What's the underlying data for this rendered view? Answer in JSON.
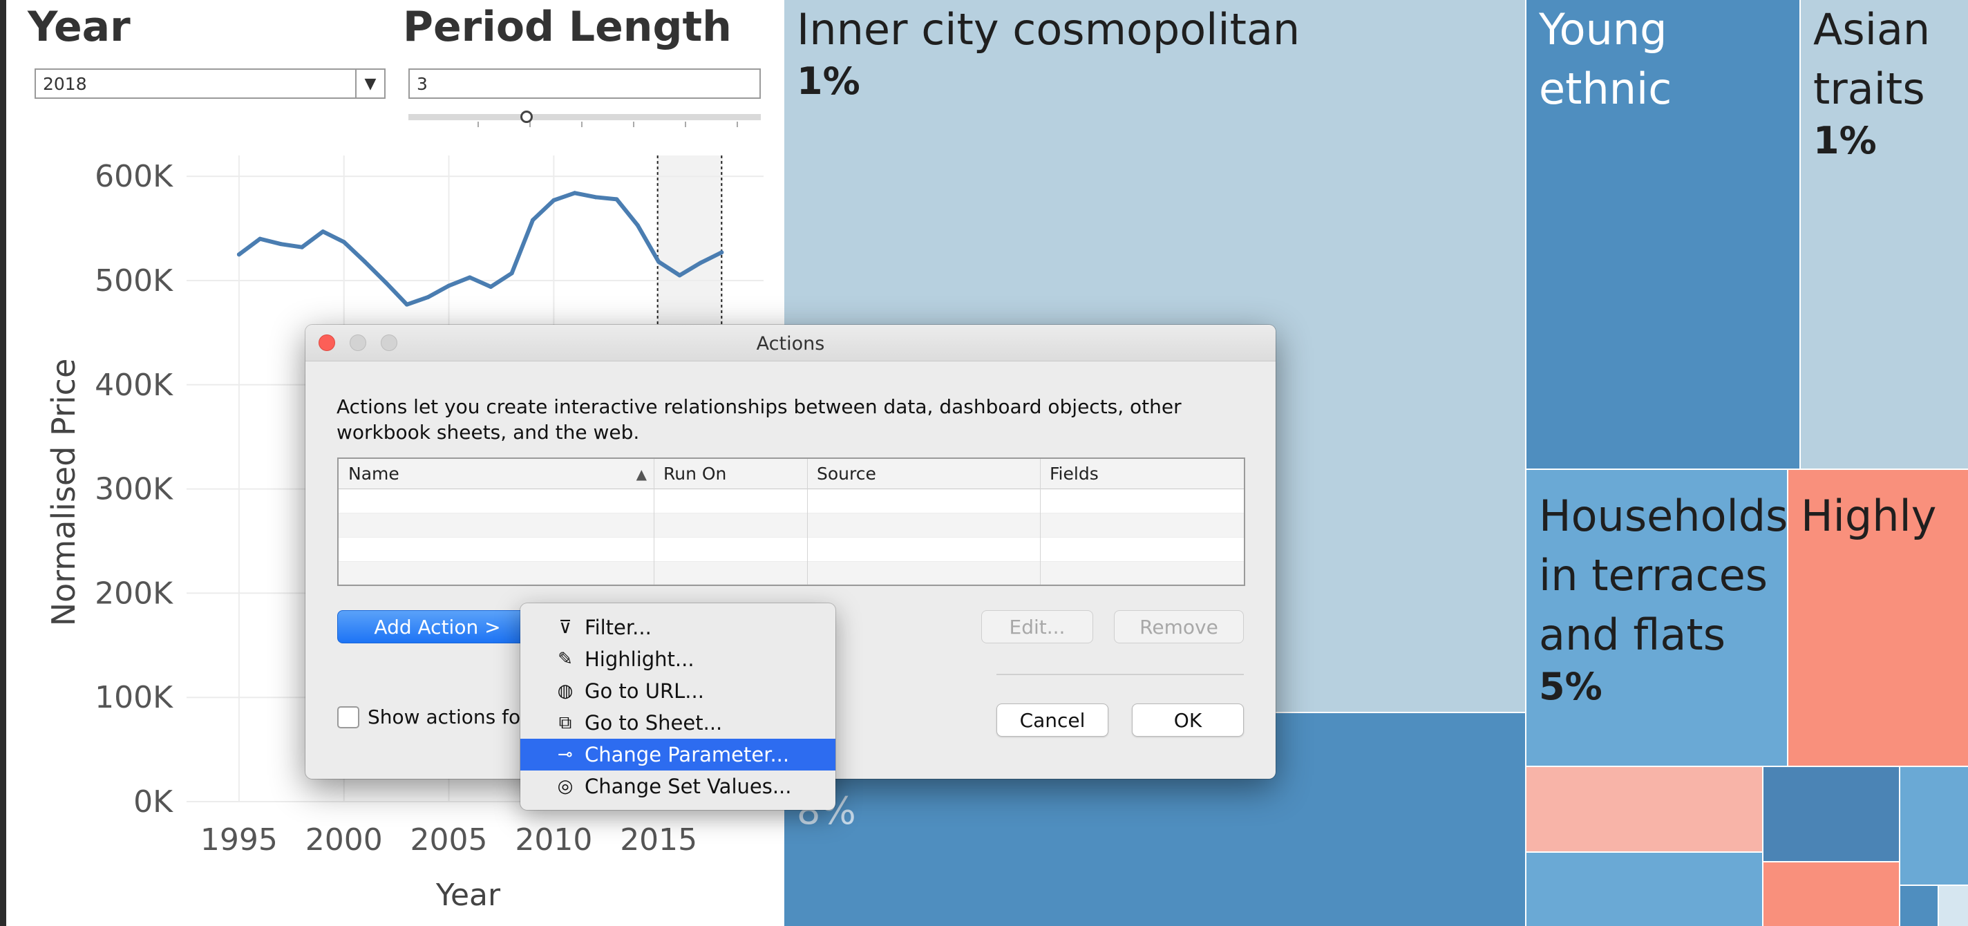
{
  "colors": {
    "line": "#4a7db1",
    "selection": "#2d6cf0",
    "dialog_bg": "#ececec",
    "close": "#fc5f57"
  },
  "params": {
    "year": {
      "title": "Year",
      "value": "2018"
    },
    "period": {
      "title": "Period Length",
      "value": "3",
      "slider_level": 0.33
    }
  },
  "chart_data": {
    "type": "line",
    "xlabel": "Year",
    "ylabel": "Normalised Price",
    "x_ticks": [
      "1995",
      "2000",
      "2005",
      "2010",
      "2015"
    ],
    "y_ticks": [
      "0K",
      "100K",
      "200K",
      "300K",
      "400K",
      "500K",
      "600K"
    ],
    "xlim": [
      1992.5,
      2020
    ],
    "ylim": [
      0,
      620000
    ],
    "x": [
      1995,
      1996,
      1997,
      1998,
      1999,
      2000,
      2001,
      2002,
      2003,
      2004,
      2005,
      2006,
      2007,
      2008,
      2009,
      2010,
      2011,
      2012,
      2013,
      2014,
      2015,
      2016,
      2017,
      2018
    ],
    "values": [
      525000,
      540000,
      535000,
      532000,
      547000,
      537000,
      518000,
      498000,
      477000,
      484000,
      495000,
      503000,
      494000,
      507000,
      558000,
      577000,
      584000,
      580000,
      578000,
      553000,
      518000,
      505000,
      517000,
      527000
    ],
    "highlight_range": [
      2015,
      2018
    ],
    "grid": true
  },
  "treemap": {
    "cells": [
      {
        "id": "inner-city",
        "label": "Inner city cosmopolitan",
        "pct": "1%",
        "color": "#b7d0df",
        "text_color": "#1f1f1f"
      },
      {
        "id": "young-ethnic",
        "label": "Young ethnic",
        "pct": "",
        "color": "#4f8ebf",
        "text_color": "#ffffff"
      },
      {
        "id": "asian-traits",
        "label": "Asian traits",
        "pct": "1%",
        "color": "#b7d0df",
        "text_color": "#1f1f1f"
      },
      {
        "id": "households-terraces",
        "label": "Households in terraces and flats",
        "pct": "5%",
        "color": "#6aa9d5",
        "text_color": "#1f1f1f"
      },
      {
        "id": "highly",
        "label": "Highly",
        "pct": "",
        "color": "#f9907c",
        "text_color": "#1f1f1f"
      },
      {
        "id": "bottom-left-8",
        "label": "",
        "pct": "8%",
        "color": "#4f8ebf",
        "text_color": "#ffffff"
      }
    ]
  },
  "dialog": {
    "title": "Actions",
    "description": "Actions let you create interactive relationships between data, dashboard objects, other workbook sheets, and the web.",
    "columns": [
      "Name",
      "Run On",
      "Source",
      "Fields"
    ],
    "sort_indicator": "▲",
    "buttons": {
      "add_action": "Add Action >",
      "edit": "Edit...",
      "remove": "Remove",
      "cancel": "Cancel",
      "ok": "OK"
    },
    "show_actions_label": "Show actions fo"
  },
  "menu": {
    "items": [
      {
        "label": "Filter...",
        "icon": "filter-icon",
        "glyph": "⊽",
        "selected": false
      },
      {
        "label": "Highlight...",
        "icon": "highlight-pen-icon",
        "glyph": "✎",
        "selected": false
      },
      {
        "label": "Go to URL...",
        "icon": "globe-icon",
        "glyph": "◍",
        "selected": false
      },
      {
        "label": "Go to Sheet...",
        "icon": "external-sheet-icon",
        "glyph": "⧉",
        "selected": false
      },
      {
        "label": "Change Parameter...",
        "icon": "parameter-icon",
        "glyph": "⊸",
        "selected": true
      },
      {
        "label": "Change Set Values...",
        "icon": "set-values-icon",
        "glyph": "◎",
        "selected": false
      }
    ]
  }
}
